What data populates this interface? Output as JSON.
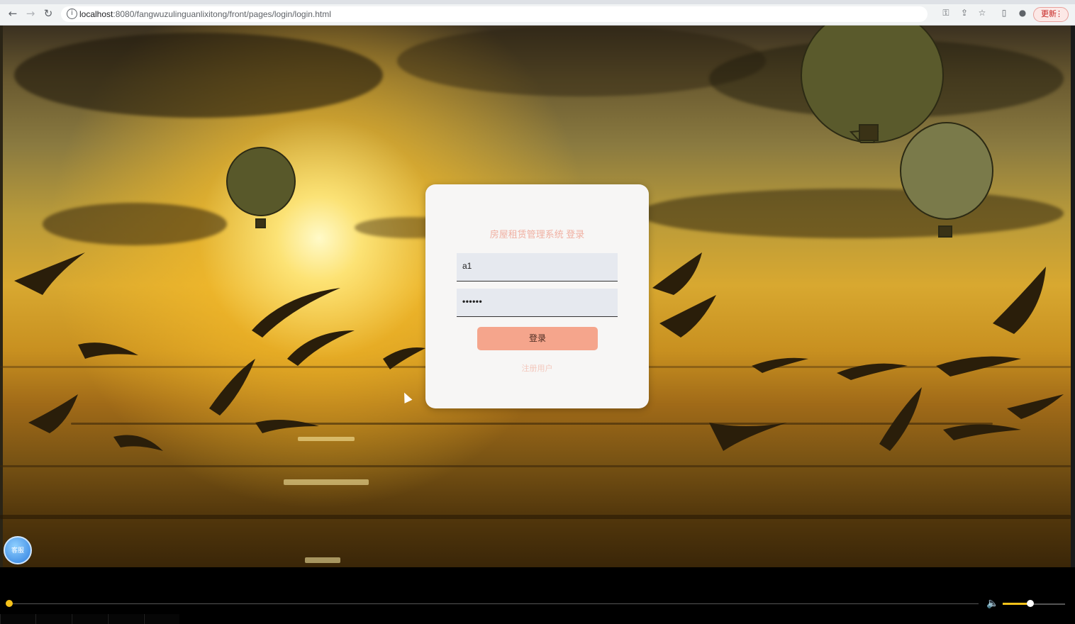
{
  "browser": {
    "url_host": "localhost",
    "url_path": ":8080/fangwuzulinguanlixitong/front/pages/login/login.html",
    "update_button": "更新",
    "icons": [
      "back-icon",
      "forward-icon",
      "reload-icon",
      "info-icon",
      "key-icon",
      "share-icon",
      "star-icon",
      "sidebar-icon",
      "profile-icon",
      "menu-dots-icon"
    ]
  },
  "login": {
    "title": "房屋租赁管理系统 登录",
    "username_value": "a1",
    "password_value": "••••••",
    "login_button": "登录",
    "register_link": "注册用户"
  },
  "avatar": {
    "label": "客服"
  },
  "player": {
    "icons": [
      "volume-icon"
    ],
    "volume": 0.45,
    "progress": 0
  },
  "colors": {
    "accent": "#f5a58c",
    "title": "#f0b0a2",
    "player_accent": "#f6c21a"
  }
}
